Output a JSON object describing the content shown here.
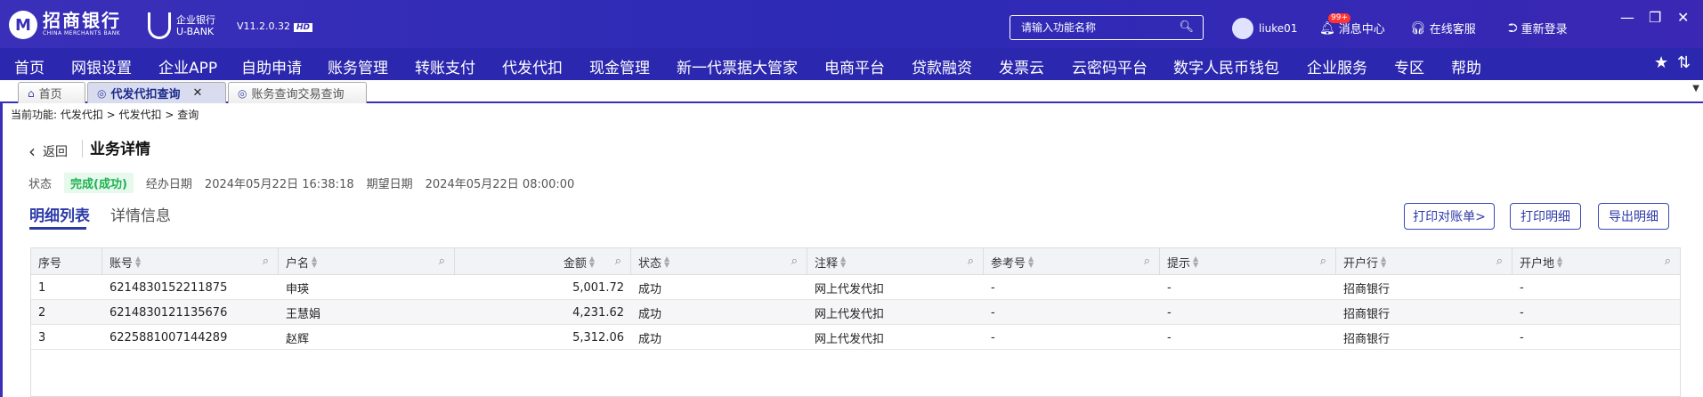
{
  "app": {
    "logo_cn": "招商银行",
    "logo_en": "CHINA MERCHANTS BANK",
    "ubank_cn": "企业银行",
    "ubank_en": "U-BANK",
    "version": "V11.2.0.32",
    "version_badge": "HD"
  },
  "header": {
    "search_placeholder": "请输入功能名称",
    "username": "liuke01",
    "message_center": "消息中心",
    "message_badge": "99+",
    "online_service": "在线客服",
    "relogin": "重新登录"
  },
  "nav": {
    "items": [
      "首页",
      "网银设置",
      "企业APP",
      "自助申请",
      "账务管理",
      "转账支付",
      "代发代扣",
      "现金管理",
      "新一代票据大管家",
      "电商平台",
      "贷款融资",
      "发票云",
      "云密码平台",
      "数字人民币钱包",
      "企业服务",
      "专区",
      "帮助"
    ]
  },
  "tabs": [
    {
      "label": "首页",
      "icon": "home-icon"
    },
    {
      "label": "代发代扣查询",
      "icon": "globe-icon",
      "active": true
    },
    {
      "label": "账务查询交易查询",
      "icon": "globe-icon"
    }
  ],
  "breadcrumb": "当前功能:  代发代扣 > 代发代扣 > 查询",
  "detail": {
    "back_label": "返回",
    "title": "业务详情",
    "status_label": "状态",
    "status_value": "完成(成功)",
    "handle_date_label": "经办日期",
    "handle_date_value": "2024年05月22日 16:38:18",
    "expect_date_label": "期望日期",
    "expect_date_value": "2024年05月22日 08:00:00"
  },
  "subtabs": [
    "明细列表",
    "详情信息"
  ],
  "buttons": {
    "print_statement": "打印对账单>",
    "print_detail": "打印明细",
    "export_detail": "导出明细"
  },
  "table": {
    "columns": [
      "序号",
      "账号",
      "户名",
      "金额",
      "状态",
      "注释",
      "参考号",
      "提示",
      "开户行",
      "开户地"
    ],
    "rows": [
      [
        "1",
        "6214830152211875",
        "申瑛",
        "5,001.72",
        "成功",
        "网上代发代扣",
        "-",
        "-",
        "招商银行",
        "-"
      ],
      [
        "2",
        "6214830121135676",
        "王慧娟",
        "4,231.62",
        "成功",
        "网上代发代扣",
        "-",
        "-",
        "招商银行",
        "-"
      ],
      [
        "3",
        "6225881007144289",
        "赵辉",
        "5,312.06",
        "成功",
        "网上代发代扣",
        "-",
        "-",
        "招商银行",
        "-"
      ]
    ]
  },
  "colors": {
    "brand": "#2b27ae",
    "accent": "#2b3aa8",
    "success": "#1fb152"
  }
}
